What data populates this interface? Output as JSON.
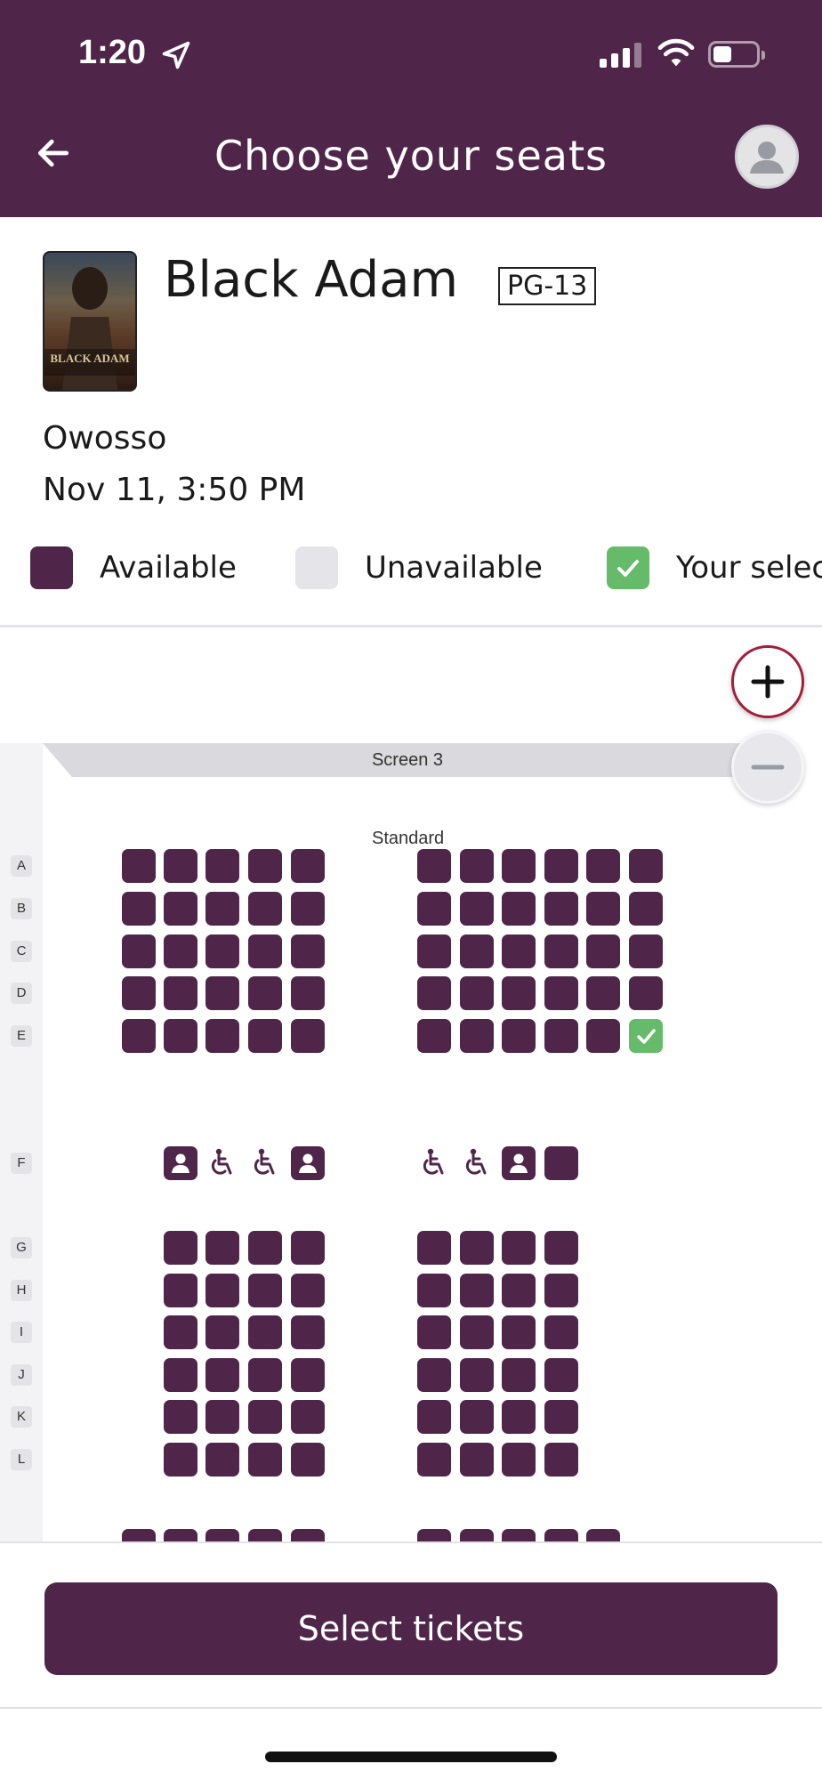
{
  "status_bar": {
    "time": "1:20"
  },
  "header": {
    "title": "Choose your seats"
  },
  "movie": {
    "title": "Black Adam",
    "rating": "PG-13",
    "theater": "Owosso",
    "showtime": "Nov 11, 3:50 PM",
    "poster_text": "BLACK ADAM"
  },
  "legend": [
    {
      "label": "Available",
      "state": "available"
    },
    {
      "label": "Unavailable",
      "state": "unavailable"
    },
    {
      "label": "Your selection",
      "state": "selected"
    }
  ],
  "seat_map": {
    "screen_label": "Screen 3",
    "section_label": "Standard",
    "rows": [
      "A",
      "B",
      "C",
      "D",
      "E",
      "F",
      "G",
      "H",
      "I",
      "J",
      "K",
      "L"
    ],
    "selected_seat": {
      "row": "E",
      "block": "right",
      "seat": 6
    },
    "colors": {
      "available": "#4f2649",
      "unavailable": "#e5e5e9",
      "selected": "#66bb6a",
      "brand": "#4f2649"
    }
  },
  "footer": {
    "button_label": "Select tickets"
  }
}
